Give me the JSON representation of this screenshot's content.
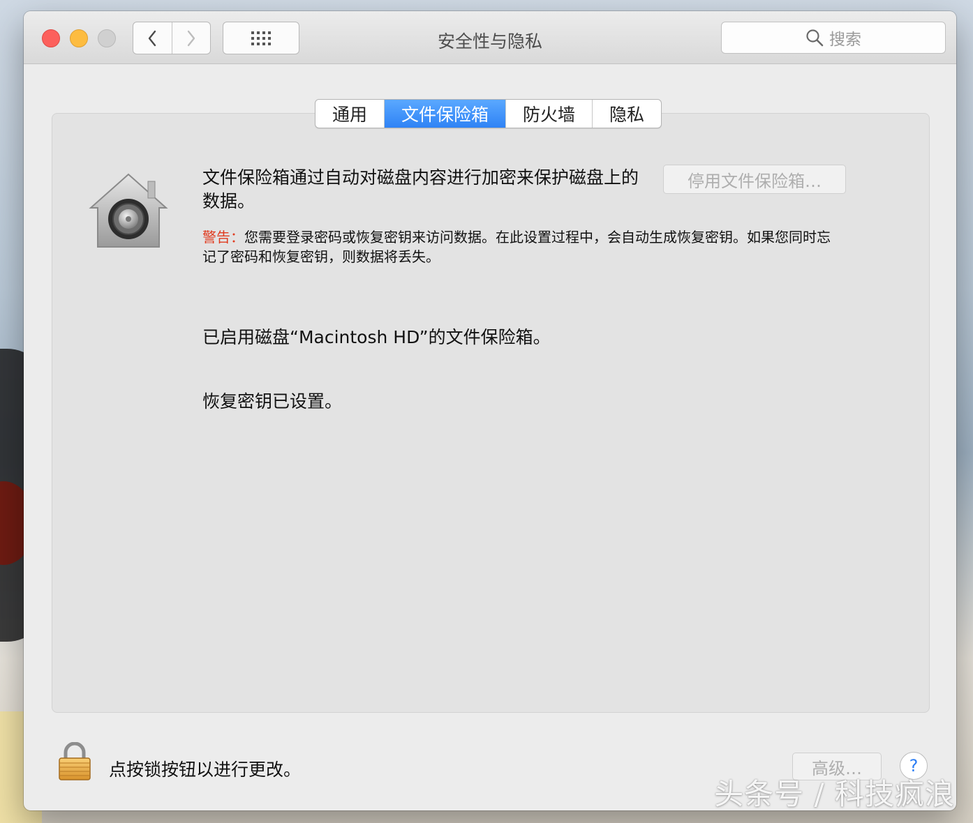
{
  "window": {
    "title": "安全性与隐私"
  },
  "search": {
    "placeholder": "搜索",
    "icon": "search-icon"
  },
  "tabs": [
    {
      "label": "通用",
      "active": false
    },
    {
      "label": "文件保险箱",
      "active": true
    },
    {
      "label": "防火墙",
      "active": false
    },
    {
      "label": "隐私",
      "active": false
    }
  ],
  "filevault": {
    "description": "文件保险箱通过自动对磁盘内容进行加密来保护磁盘上的数据。",
    "disable_button": "停用文件保险箱…",
    "warning_label": "警告：",
    "warning_text": "您需要登录密码或恢复密钥来访问数据。在此设置过程中，会自动生成恢复密钥。如果您同时忘记了密码和恢复密钥，则数据将丢失。",
    "status_enabled": "已启用磁盘“Macintosh HD”的文件保险箱。",
    "status_recovery": "恢复密钥已设置。"
  },
  "footer": {
    "lock_text": "点按锁按钮以进行更改。",
    "advanced_button": "高级…",
    "help_button": "?"
  },
  "watermark": "头条号 / 科技疯浪",
  "colors": {
    "accent": "#2f83f5",
    "warning": "#e03a1e",
    "close": "#fc605c",
    "minimize": "#fdbc40"
  }
}
